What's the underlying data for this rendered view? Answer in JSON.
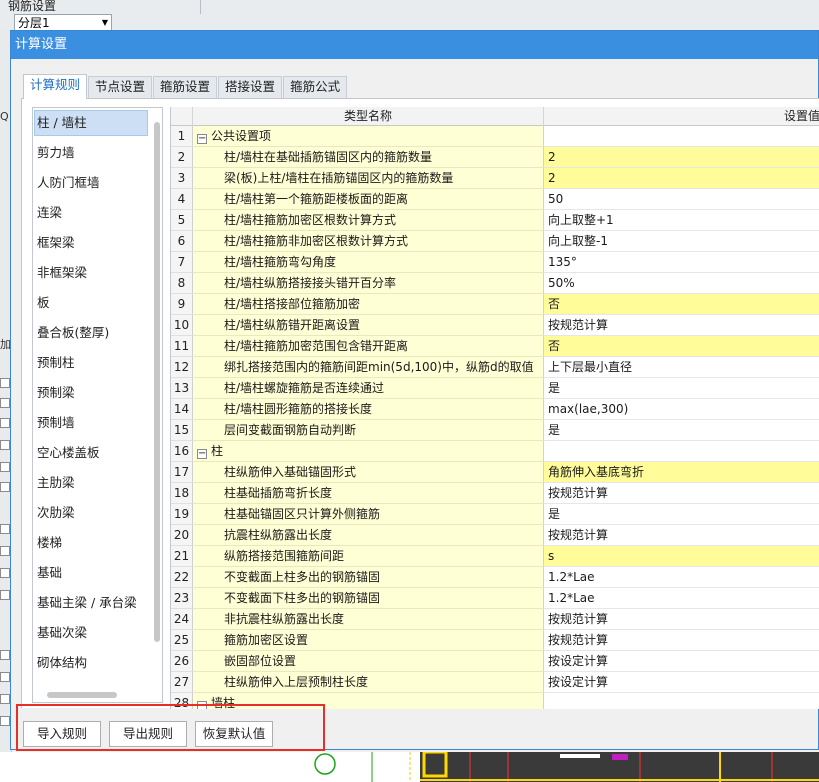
{
  "background": {
    "title_fragment": "钢筋设置",
    "floor_selector": "分层1",
    "left_labels": [
      "Q",
      "加"
    ]
  },
  "dialog": {
    "title": "计算设置",
    "tabs": [
      {
        "label": "计算规则",
        "active": true
      },
      {
        "label": "节点设置",
        "active": false
      },
      {
        "label": "箍筋设置",
        "active": false
      },
      {
        "label": "搭接设置",
        "active": false
      },
      {
        "label": "箍筋公式",
        "active": false
      }
    ],
    "left_list": [
      {
        "label": "柱 / 墙柱",
        "selected": true
      },
      {
        "label": "剪力墙"
      },
      {
        "label": "人防门框墙"
      },
      {
        "label": "连梁"
      },
      {
        "label": "框架梁"
      },
      {
        "label": "非框架梁"
      },
      {
        "label": "板"
      },
      {
        "label": "叠合板(整厚)"
      },
      {
        "label": "预制柱"
      },
      {
        "label": "预制梁"
      },
      {
        "label": "预制墙"
      },
      {
        "label": "空心楼盖板"
      },
      {
        "label": "主肋梁"
      },
      {
        "label": "次肋梁"
      },
      {
        "label": "楼梯"
      },
      {
        "label": "基础"
      },
      {
        "label": "基础主梁 / 承台梁"
      },
      {
        "label": "基础次梁"
      },
      {
        "label": "砌体结构"
      }
    ],
    "grid": {
      "headers": {
        "name": "类型名称",
        "value": "设置值"
      },
      "rows": [
        {
          "num": "1",
          "name": "公共设置项",
          "value": "",
          "group": true,
          "expander": "−"
        },
        {
          "num": "2",
          "name": "柱/墙柱在基础插筋锚固区内的箍筋数量",
          "value": "2",
          "hl": true
        },
        {
          "num": "3",
          "name": "梁(板)上柱/墙柱在插筋锚固区内的箍筋数量",
          "value": "2",
          "hl": true
        },
        {
          "num": "4",
          "name": "柱/墙柱第一个箍筋距楼板面的距离",
          "value": "50"
        },
        {
          "num": "5",
          "name": "柱/墙柱箍筋加密区根数计算方式",
          "value": "向上取整+1"
        },
        {
          "num": "6",
          "name": "柱/墙柱箍筋非加密区根数计算方式",
          "value": "向上取整-1"
        },
        {
          "num": "7",
          "name": "柱/墙柱箍筋弯勾角度",
          "value": "135°"
        },
        {
          "num": "8",
          "name": "柱/墙柱纵筋搭接接头错开百分率",
          "value": "50%"
        },
        {
          "num": "9",
          "name": "柱/墙柱搭接部位箍筋加密",
          "value": "否",
          "hl": true
        },
        {
          "num": "10",
          "name": "柱/墙柱纵筋错开距离设置",
          "value": "按规范计算"
        },
        {
          "num": "11",
          "name": "柱/墙柱箍筋加密范围包含错开距离",
          "value": "否",
          "hl": true
        },
        {
          "num": "12",
          "name": "绑扎搭接范围内的箍筋间距min(5d,100)中，纵筋d的取值",
          "value": "上下层最小直径"
        },
        {
          "num": "13",
          "name": "柱/墙柱螺旋箍筋是否连续通过",
          "value": "是"
        },
        {
          "num": "14",
          "name": "柱/墙柱圆形箍筋的搭接长度",
          "value": "max(lae,300)"
        },
        {
          "num": "15",
          "name": "层间变截面钢筋自动判断",
          "value": "是"
        },
        {
          "num": "16",
          "name": "柱",
          "value": "",
          "group": true,
          "expander": "−"
        },
        {
          "num": "17",
          "name": "柱纵筋伸入基础锚固形式",
          "value": "角筋伸入基底弯折",
          "hl": true
        },
        {
          "num": "18",
          "name": "柱基础插筋弯折长度",
          "value": "按规范计算"
        },
        {
          "num": "19",
          "name": "柱基础锚固区只计算外侧箍筋",
          "value": "是"
        },
        {
          "num": "20",
          "name": "抗震柱纵筋露出长度",
          "value": "按规范计算"
        },
        {
          "num": "21",
          "name": "纵筋搭接范围箍筋间距",
          "value": "s",
          "hl": true
        },
        {
          "num": "22",
          "name": "不变截面上柱多出的钢筋锚固",
          "value": "1.2*Lae"
        },
        {
          "num": "23",
          "name": "不变截面下柱多出的钢筋锚固",
          "value": "1.2*Lae"
        },
        {
          "num": "24",
          "name": "非抗震柱纵筋露出长度",
          "value": "按规范计算"
        },
        {
          "num": "25",
          "name": "箍筋加密区设置",
          "value": "按规范计算"
        },
        {
          "num": "26",
          "name": "嵌固部位设置",
          "value": "按设定计算"
        },
        {
          "num": "27",
          "name": "柱纵筋伸入上层预制柱长度",
          "value": "按设定计算"
        },
        {
          "num": "28",
          "name": "墙柱",
          "value": "",
          "group": true,
          "expander": "−"
        }
      ]
    },
    "buttons": {
      "import": "导入规则",
      "export": "导出规则",
      "restore": "恢复默认值"
    },
    "colors": {
      "title_bar": "#3b8fe0",
      "name_cell": "#ffffd5",
      "value_highlight": "#fffc99",
      "annotation_box": "#e5302a"
    }
  }
}
